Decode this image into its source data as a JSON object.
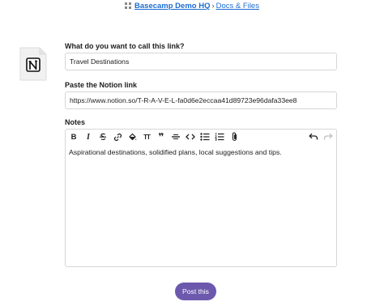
{
  "breadcrumb": {
    "project": "Basecamp Demo HQ",
    "separator": "›",
    "section": "Docs & Files"
  },
  "form": {
    "title_label": "What do you want to call this link?",
    "title_value": "Travel Destinations",
    "link_label": "Paste the Notion link",
    "link_value": "https://www.notion.so/T-R-A-V-E-L-fa0d6e2eccaa41d89723e96dafa33ee8",
    "notes_label": "Notes",
    "notes_value": "Aspirational destinations, solidified plans, local suggestions and tips.",
    "submit_label": "Post this"
  },
  "toolbar": {
    "bold": "B",
    "italic": "I",
    "heading": "TT",
    "quote": "❞"
  },
  "icons": {
    "doc_icon": "notion-logo-icon",
    "grid_icon": "project-grid-icon"
  }
}
